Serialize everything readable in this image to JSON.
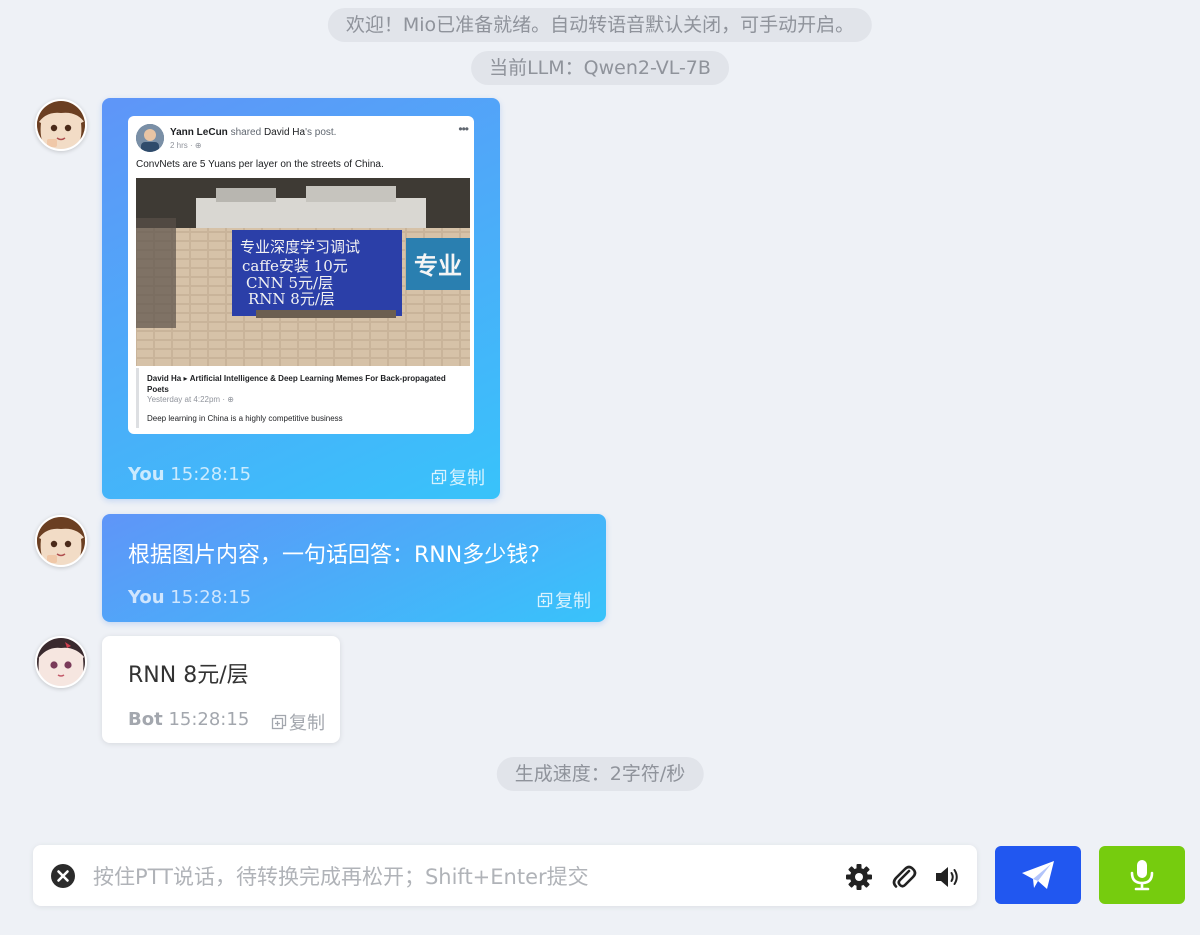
{
  "system": {
    "welcome": "欢迎！Mio已准备就绪。自动转语音默认关闭，可手动开启。",
    "llm": "当前LLM：Qwen2-VL-7B",
    "speed": "生成速度：2字符/秒"
  },
  "messages": [
    {
      "role": "user",
      "who": "You",
      "time": "15:28:15",
      "copy": "复制",
      "image": {
        "author": "Yann LeCun",
        "shared": "shared",
        "source": "David Ha",
        "suffix": "'s post.",
        "age": "2 hrs",
        "text": "ConvNets are 5 Yuans per layer on the streets of China.",
        "sign_lines": [
          "专业深度学习调试",
          "caffe安装 10元",
          "CNN 5元/层",
          "RNN 8元/层"
        ],
        "sign2": "专业",
        "share_author": "David Ha",
        "share_group": "Artificial Intelligence & Deep Learning Memes For Back-propagated Poets",
        "share_time": "Yesterday at 4:22pm",
        "share_text": "Deep learning in China is a highly competitive business"
      }
    },
    {
      "role": "user",
      "who": "You",
      "time": "15:28:15",
      "copy": "复制",
      "text": "根据图片内容，一句话回答：RNN多少钱？"
    },
    {
      "role": "bot",
      "who": "Bot",
      "time": "15:28:15",
      "copy": "复制",
      "text": "RNN 8元/层"
    }
  ],
  "input": {
    "placeholder": "按住PTT说话，待转换完成再松开；Shift+Enter提交",
    "value": ""
  },
  "icons": {
    "clear": "close-circle-icon",
    "settings": "gear-icon",
    "attach": "paperclip-icon",
    "volume": "speaker-icon",
    "send": "paper-plane-icon",
    "mic": "microphone-icon"
  },
  "colors": {
    "send": "#2157f0",
    "mic": "#76cc0e",
    "user_bubble_start": "#5f95f8",
    "user_bubble_end": "#38c3fa"
  }
}
